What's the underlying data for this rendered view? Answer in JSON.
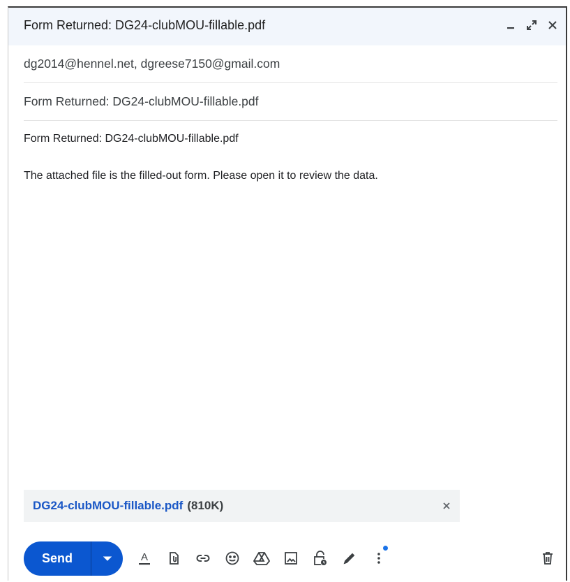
{
  "window": {
    "title": "Form Returned: DG24-clubMOU-fillable.pdf",
    "controls": [
      "minimize-icon",
      "expand-icon",
      "close-icon"
    ]
  },
  "recipients": "dg2014@hennel.net, dgreese7150@gmail.com",
  "subject": "Form Returned: DG24-clubMOU-fillable.pdf",
  "body": {
    "line1": "Form Returned: DG24-clubMOU-fillable.pdf",
    "line2": "The attached file is the filled-out form. Please open it to review the data."
  },
  "attachment": {
    "name": "DG24-clubMOU-fillable.pdf",
    "size": "(810K)"
  },
  "toolbar": {
    "send_label": "Send",
    "tools": [
      "format-text-icon",
      "attach-file-icon",
      "insert-link-icon",
      "emoji-icon",
      "drive-icon",
      "insert-photo-icon",
      "confidential-mode-icon",
      "signature-icon",
      "more-options-icon"
    ],
    "discard": "delete-icon"
  },
  "colors": {
    "accent": "#0b57d0",
    "link": "#1a57c6",
    "titlebar": "#f2f6fc"
  }
}
